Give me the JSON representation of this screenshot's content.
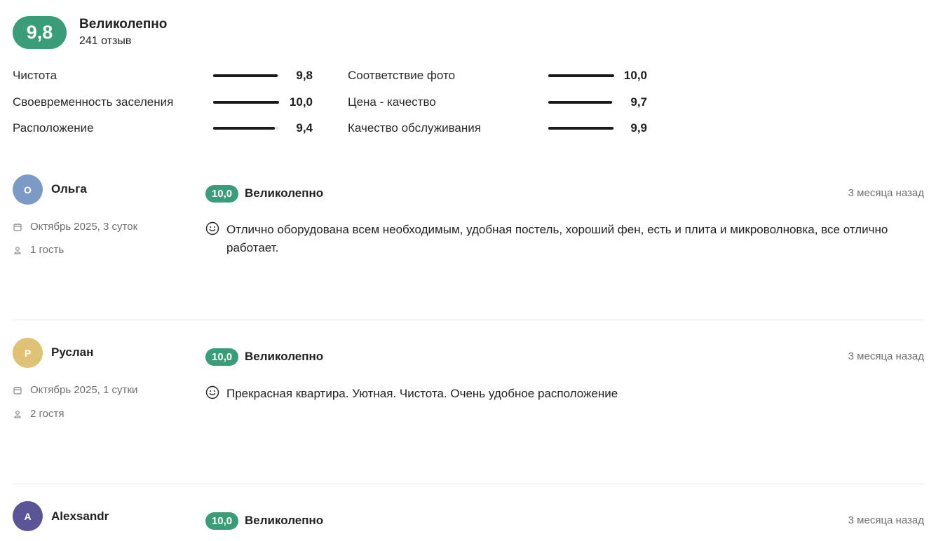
{
  "summary": {
    "score": "9,8",
    "title": "Великолепно",
    "count": "241 отзыв"
  },
  "categories": [
    {
      "label": "Чистота",
      "value": "9,8",
      "fraction": 0.98
    },
    {
      "label": "Своевременность заселения",
      "value": "10,0",
      "fraction": 1.0
    },
    {
      "label": "Расположение",
      "value": "9,4",
      "fraction": 0.94
    },
    {
      "label": "Соответствие фото",
      "value": "10,0",
      "fraction": 1.0
    },
    {
      "label": "Цена - качество",
      "value": "9,7",
      "fraction": 0.97
    },
    {
      "label": "Качество обслуживания",
      "value": "9,9",
      "fraction": 0.99
    }
  ],
  "colors": {
    "badge": "#3a9d7a",
    "bar": "#1a1a1a",
    "track": "#e6e6e6"
  },
  "reviews": [
    {
      "initial": "О",
      "author": "Ольга",
      "avatar_color": "#7b9bc6",
      "stay": "Октябрь 2025, 3 суток",
      "guests": "1 гость",
      "score": "10,0",
      "title": "Великолепно",
      "date": "3 месяца назад",
      "text": "Отлично оборудована всем необходимым, удобная постель, хороший фен, есть и плита и микроволновка, все отлично работает."
    },
    {
      "initial": "Р",
      "author": "Руслан",
      "avatar_color": "#dfc276",
      "stay": "Октябрь 2025, 1 сутки",
      "guests": "2 гостя",
      "score": "10,0",
      "title": "Великолепно",
      "date": "3 месяца назад",
      "text": "Прекрасная квартира. Уютная. Чистота. Очень удобное расположение"
    },
    {
      "initial": "A",
      "author": "Alexsandr",
      "avatar_color": "#5b5496",
      "score": "10,0",
      "title": "Великолепно",
      "date": "3 месяца назад"
    }
  ],
  "icons": {
    "calendar": "calendar-icon",
    "guest": "person-icon",
    "positive": "smile-icon"
  }
}
